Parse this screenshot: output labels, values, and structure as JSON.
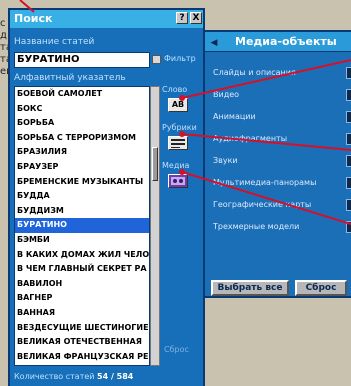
{
  "search": {
    "title": "Поиск",
    "help_label": "?",
    "close_label": "X",
    "title_label": "Название статей",
    "query": "БУРАТИНО",
    "filter_label": "Фильтр",
    "index_label": "Алфавитный указатель",
    "word_label": "Слово",
    "word_icon": "AB",
    "rubric_label": "Рубрики",
    "media_label": "Медиа",
    "reset_label": "Сброс",
    "count_label": "Количество статей",
    "count_value": "54 / 584",
    "items": [
      "БОЕВОЙ САМОЛЕТ",
      "БОКС",
      "БОРЬБА",
      "БОРЬБА С ТЕРРОРИЗМОМ",
      "БРАЗИЛИЯ",
      "БРАУЗЕР",
      "БРЕМЕНСКИЕ МУЗЫКАНТЫ",
      "БУДДА",
      "БУДДИЗМ",
      "БУРАТИНО",
      "БЭМБИ",
      "В КАКИХ ДОМАХ ЖИЛ ЧЕЛОВ",
      "В ЧЕМ ГЛАВНЫЙ СЕКРЕТ РА",
      "ВАВИЛОН",
      "ВАГНЕР",
      "ВАННАЯ",
      "ВЕЗДЕСУЩИЕ ШЕСТИНОГИЕ",
      "ВЕЛИКАЯ ОТЕЧЕСТВЕННАЯ",
      "ВЕЛИКАЯ ФРАНЦУЗСКАЯ РЕ"
    ],
    "selected_index": 9
  },
  "media": {
    "title": "Медиа-объекты",
    "menu_icon": "◀",
    "rows": [
      {
        "label": "Слайды и описания",
        "icon": "slides-icon"
      },
      {
        "label": "Видео",
        "icon": "video-icon"
      },
      {
        "label": "Анимации",
        "icon": "animation-icon"
      },
      {
        "label": "Аудиофрагменты",
        "icon": "audio-icon"
      },
      {
        "label": "Звуки",
        "icon": "sound-icon"
      },
      {
        "label": "Мультимедиа-панорамы",
        "icon": "panorama-icon"
      },
      {
        "label": "Географические карты",
        "icon": "map-icon"
      },
      {
        "label": "Трехмерные модели",
        "icon": "3d-icon"
      }
    ],
    "select_all_label": "Выбрать все",
    "reset_label": "Сброс"
  },
  "background": {
    "side_text": [
      "с д",
      "тат",
      "тад",
      "еи",
      "ме"
    ]
  },
  "colors": {
    "window_blue": "#166fb8",
    "title_blue": "#38b0e6",
    "pointer_red": "#d6102a"
  }
}
